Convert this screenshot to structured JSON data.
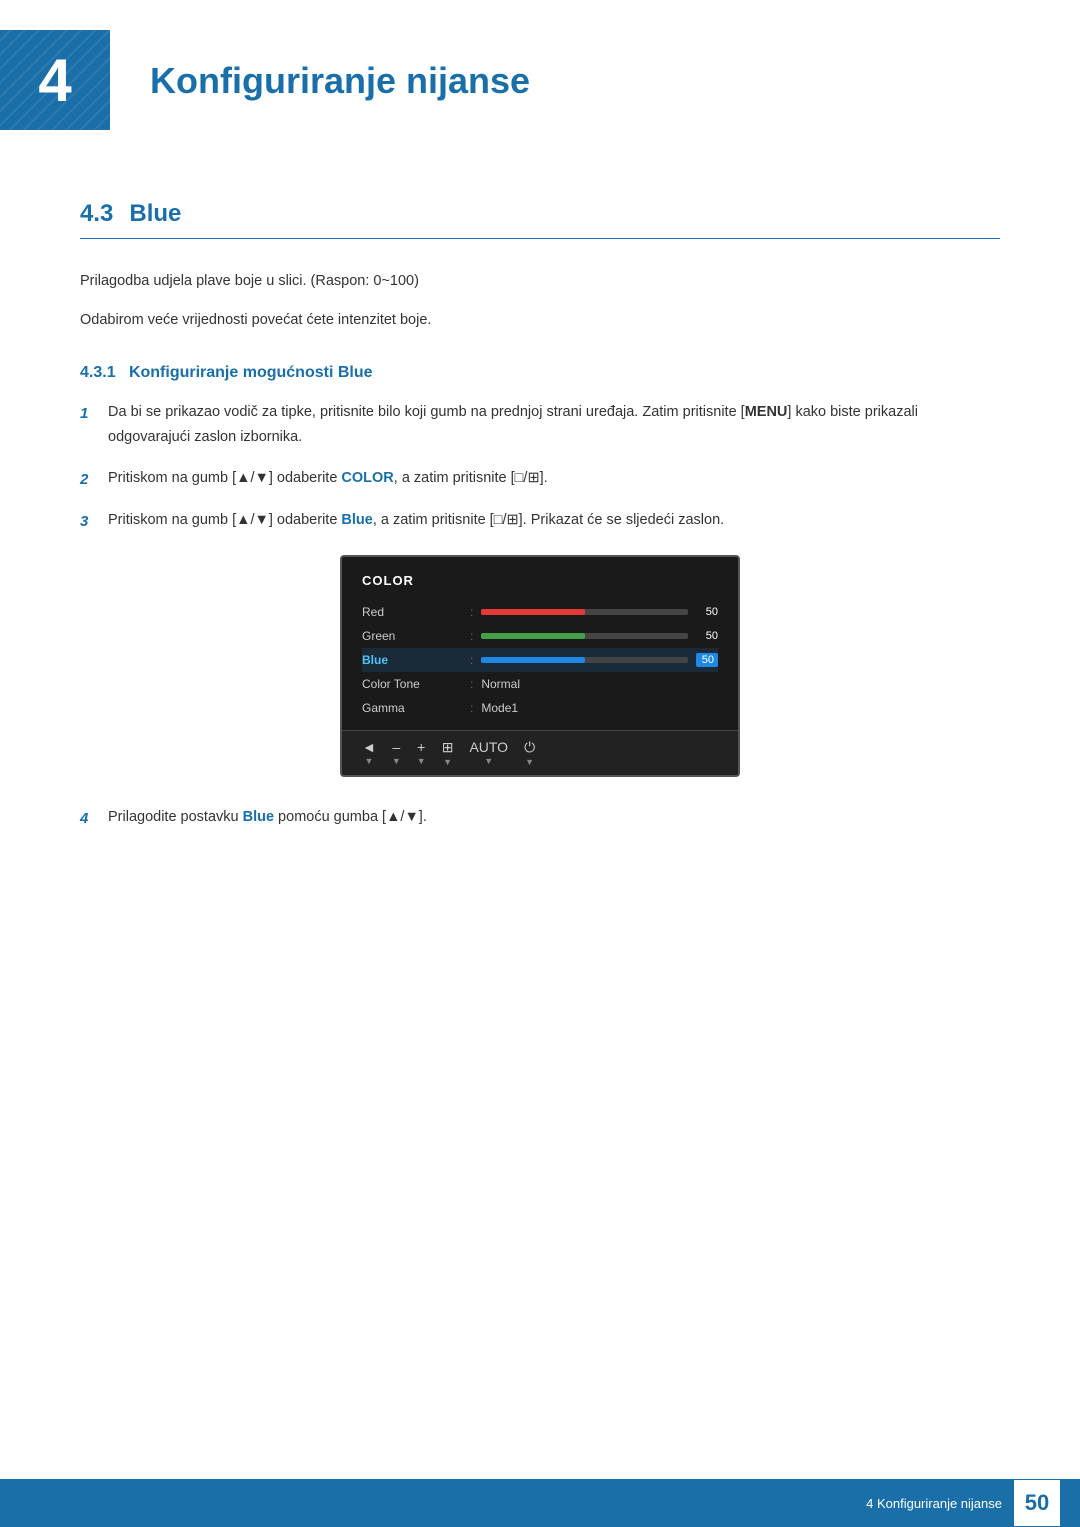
{
  "header": {
    "chapter_number": "4",
    "chapter_title": "Konfiguriranje nijanse"
  },
  "section": {
    "number": "4.3",
    "title": "Blue",
    "body1": "Prilagodba udjela plave boje u slici. (Raspon: 0~100)",
    "body2": "Odabirom veće vrijednosti povećat ćete intenzitet boje.",
    "subsection_number": "4.3.1",
    "subsection_title": "Konfiguriranje mogućnosti Blue"
  },
  "steps": [
    {
      "num": "1",
      "text": "Da bi se prikazao vodič za tipke, pritisnite bilo koji gumb na prednjoj strani uređaja. Zatim pritisnite [",
      "key": "MENU",
      "text2": "] kako biste prikazali odgovarajući zaslon izbornika."
    },
    {
      "num": "2",
      "text": "Pritiskom na gumb [▲/▼] odaberite ",
      "bold": "COLOR",
      "text2": ", a zatim pritisnite [□/⊞]."
    },
    {
      "num": "3",
      "text": "Pritiskom na gumb [▲/▼] odaberite ",
      "bold": "Blue",
      "text2": ", a zatim pritisnite [□/⊞]. Prikazat će se sljedeći zaslon."
    },
    {
      "num": "4",
      "text": "Prilagodite postavku ",
      "bold": "Blue",
      "text2": " pomoću gumba [▲/▼]."
    }
  ],
  "monitor_menu": {
    "title": "COLOR",
    "rows": [
      {
        "label": "Red",
        "type": "bar",
        "fill_pct": 50,
        "value": "50",
        "color": "red",
        "active": false
      },
      {
        "label": "Green",
        "type": "bar",
        "fill_pct": 50,
        "value": "50",
        "color": "green",
        "active": false
      },
      {
        "label": "Blue",
        "type": "bar",
        "fill_pct": 50,
        "value": "50",
        "color": "blue",
        "active": true
      },
      {
        "label": "Color Tone",
        "type": "text",
        "value": "Normal",
        "active": false
      },
      {
        "label": "Gamma",
        "type": "text",
        "value": "Mode1",
        "active": false
      }
    ],
    "controls": [
      "◄",
      "–",
      "+",
      "⊞",
      "AUTO",
      "⏻"
    ]
  },
  "footer": {
    "text": "4 Konfiguriranje nijanse",
    "page_number": "50"
  }
}
